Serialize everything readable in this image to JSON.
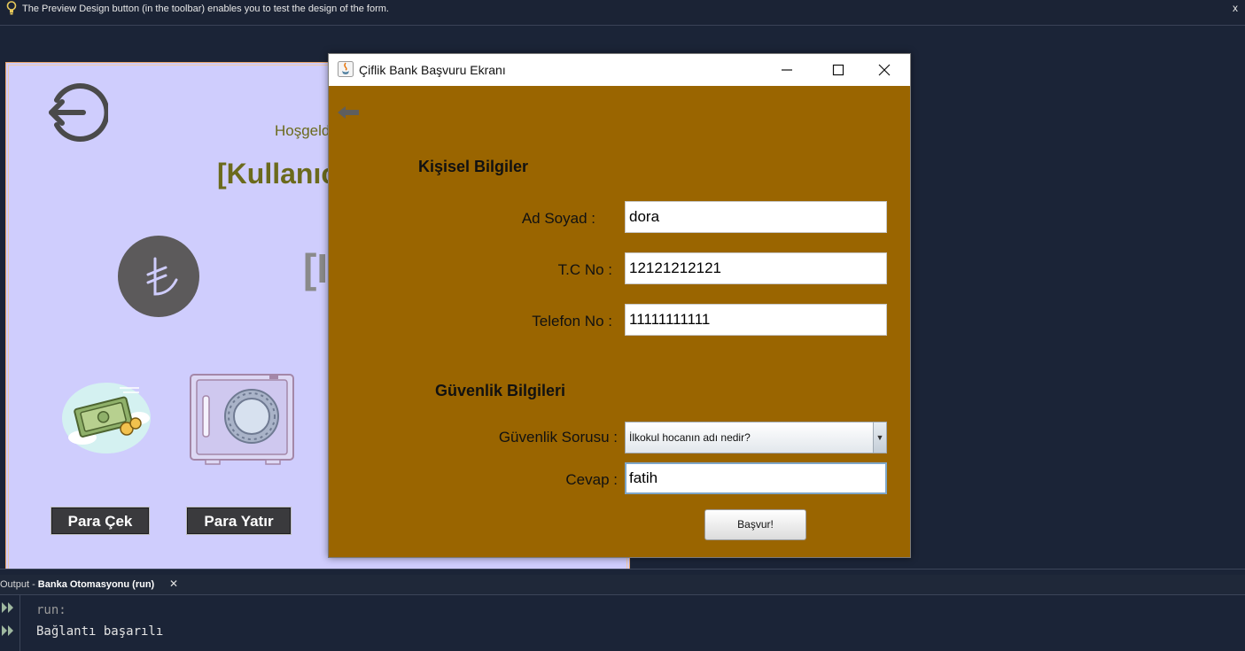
{
  "hint_bar": {
    "text": "The Preview Design button (in the toolbar) enables you to test the design of the form.",
    "close_label": "x"
  },
  "bank_form": {
    "welcome": "Hoşgeld",
    "username": "[Kullanıc",
    "balance": "[I",
    "buttons": {
      "withdraw": "Para Çek",
      "deposit": "Para Yatır"
    },
    "icons": [
      "logout-icon",
      "turkish-lira-icon",
      "money-icon",
      "safe-icon"
    ]
  },
  "dialog": {
    "title": "Çiflik Bank Başvuru Ekranı",
    "personal_section": "Kişisel Bilgiler",
    "security_section": "Güvenlik Bilgileri",
    "fields": {
      "name_label": "Ad Soyad :",
      "name_value": "dora",
      "tc_label": "T.C No :",
      "tc_value": "12121212121",
      "phone_label": "Telefon No :",
      "phone_value": "11111111111",
      "question_label": "Güvenlik Sorusu :",
      "question_value": "İlkokul hocanın adı nedir?",
      "answer_label": "Cevap :",
      "answer_value": "fatih"
    },
    "submit_label": "Başvur!"
  },
  "output": {
    "tab_prefix": "Output - ",
    "tab_title": "Banka Otomasyonu (run)",
    "close_label": "✕",
    "lines": [
      "run:",
      "Bağlantı başarılı"
    ]
  },
  "colors": {
    "ide_background": "#1a2236",
    "form_background": "#cfcdfd",
    "dialog_background": "#9a6500",
    "form_text": "#6b6a1c"
  }
}
